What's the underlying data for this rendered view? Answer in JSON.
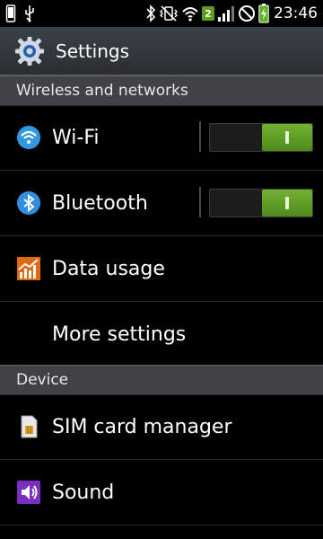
{
  "status_bar": {
    "time": "23:46",
    "sim_badge": "2",
    "icons": [
      "phone-icon",
      "usb-icon",
      "bluetooth-icon",
      "mute-vibrate-icon",
      "wifi-icon",
      "sim-icon",
      "signal-icon",
      "no-sim-icon",
      "battery-charging-icon"
    ]
  },
  "header": {
    "title": "Settings",
    "icon": "gear-icon"
  },
  "sections": {
    "wireless": "Wireless and networks",
    "device": "Device"
  },
  "items": {
    "wifi": {
      "label": "Wi-Fi",
      "toggle_on": true,
      "icon": "wifi-icon"
    },
    "bluetooth": {
      "label": "Bluetooth",
      "toggle_on": true,
      "icon": "bluetooth-icon"
    },
    "data_usage": {
      "label": "Data usage",
      "icon": "chart-icon"
    },
    "more_settings": {
      "label": "More settings"
    },
    "sim_manager": {
      "label": "SIM card manager",
      "icon": "sim-card-icon"
    },
    "sound": {
      "label": "Sound",
      "icon": "speaker-icon"
    }
  },
  "colors": {
    "toggle_on": "#5a9e1e",
    "section_bg": "#3f4347",
    "wifi_blue": "#2f9ae0"
  }
}
